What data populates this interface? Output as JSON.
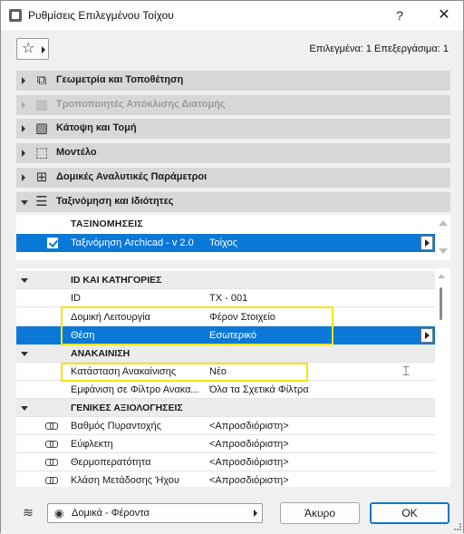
{
  "window": {
    "title": "Ρυθμίσεις Επιλεγμένου Τοίχου",
    "help_label": "?",
    "close_label": "✕"
  },
  "favorites": {
    "star_icon": "☆",
    "selected_info": "Επιλεγμένα: 1 Επεξεργάσιμα: 1"
  },
  "panels": [
    {
      "label": "Γεωμετρία και Τοποθέτηση",
      "icon": "geometry-icon",
      "glyph": "⧉",
      "expanded": false,
      "disabled": false
    },
    {
      "label": "Τροποποιητές Απόκλισης Διατομής",
      "icon": "profile-modifier-icon",
      "glyph": "▦",
      "expanded": false,
      "disabled": true
    },
    {
      "label": "Κάτοψη και Τομή",
      "icon": "floorplan-section-icon",
      "glyph": "▧",
      "expanded": false,
      "disabled": false
    },
    {
      "label": "Μοντέλο",
      "icon": "model-icon",
      "glyph": "⬚",
      "expanded": false,
      "disabled": false
    },
    {
      "label": "Δομικές Αναλυτικές Παράμετροι",
      "icon": "structural-analysis-icon",
      "glyph": "⊞",
      "expanded": false,
      "disabled": false
    },
    {
      "label": "Ταξινόμηση και Ιδιότητες",
      "icon": "classification-properties-icon",
      "glyph": "☰",
      "expanded": true,
      "disabled": false
    }
  ],
  "classifications": {
    "header": "ΤΑΞΙΝΟΜΗΣΕΙΣ",
    "row": {
      "checked": true,
      "name": "Ταξινόμηση Archicad - v 2.0",
      "value": "Τοίχος"
    }
  },
  "properties": {
    "groups": [
      {
        "label": "ID ΚΑΙ ΚΑΤΗΓΟΡΙΕΣ",
        "rows": [
          {
            "name": "ID",
            "value": "ΤΧ - 001"
          },
          {
            "name": "Δομική Λειτουργία",
            "value": "Φέρον Στοιχείο"
          },
          {
            "name": "Θέση",
            "value": "Εσωτερικό",
            "selected": true
          }
        ]
      },
      {
        "label": "ΑΝΑΚΑΙΝΙΣΗ",
        "rows": [
          {
            "name": "Κατάσταση Ανακαίνισης",
            "value": "Νέο"
          },
          {
            "name": "Εμφάνιση σε Φίλτρο Ανακα...",
            "value": "Όλα τα Σχετικά Φίλτρα"
          }
        ]
      },
      {
        "label": "ΓΕΝΙΚΕΣ ΑΞΙΟΛΟΓΗΣΕΙΣ",
        "rows": [
          {
            "name": "Βαθμός Πυραντοχής",
            "value": "<Απροσδιόριστη>"
          },
          {
            "name": "Εύφλεκτη",
            "value": "<Απροσδιόριστη>"
          },
          {
            "name": "Θερμοπερατότητα",
            "value": "<Απροσδιόριστη>"
          },
          {
            "name": "Κλάση Μετάδοσης Ήχου",
            "value": "<Απροσδιόριστη>"
          }
        ]
      }
    ]
  },
  "bottom": {
    "layer_value": "Δομικά - Φέροντα",
    "cancel_label": "Άκυρο",
    "ok_label": "OK"
  },
  "colors": {
    "selection": "#0a78d7",
    "highlight": "#f1e600",
    "panel_header": "#d7d7d7"
  }
}
